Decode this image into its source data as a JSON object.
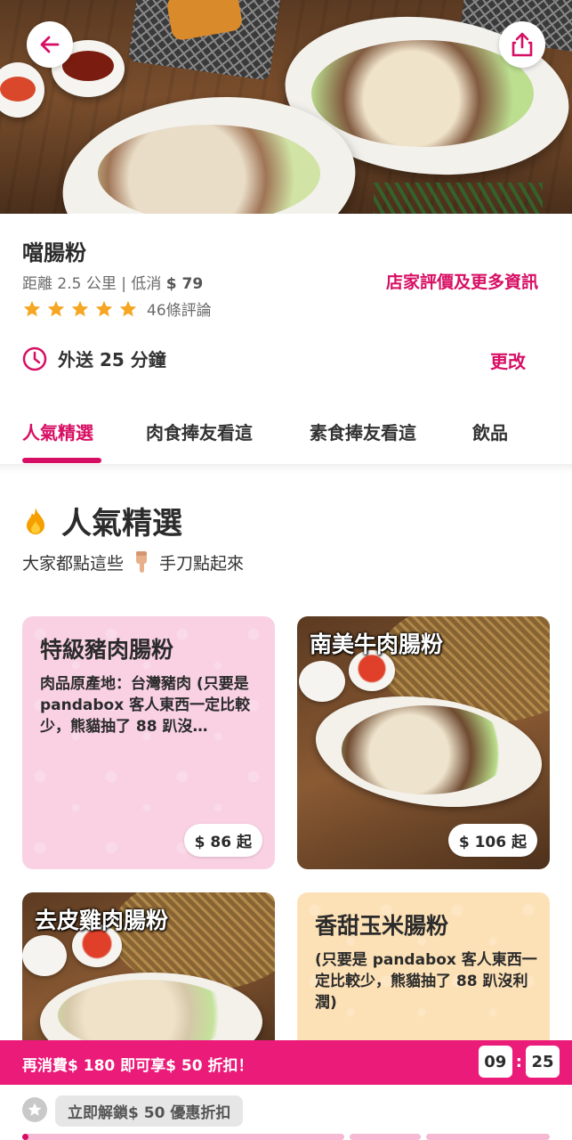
{
  "header": {
    "back_icon": "arrow-left-icon",
    "share_icon": "share-icon"
  },
  "shop": {
    "name": "噹腸粉",
    "distance_label": "距離 2.5 公里 | 低消 ",
    "min_order": "$ 79",
    "more_info": "店家評價及更多資訊",
    "rating_stars": 5,
    "rating_count": "46條評論",
    "star_color": "#f5a623"
  },
  "delivery": {
    "clock_icon": "clock-icon",
    "label": "外送 25 分鐘",
    "change": "更改"
  },
  "tabs": [
    {
      "label": "人氣精選",
      "active": true
    },
    {
      "label": "肉食捧友看這",
      "active": false
    },
    {
      "label": "素食捧友看這",
      "active": false
    },
    {
      "label": "飲品",
      "active": false
    }
  ],
  "section": {
    "fire_icon": "fire-icon",
    "title": "人氣精選",
    "subtitle_before": "大家都點這些",
    "pointing_icon": "pointing-down-hand-icon",
    "subtitle_after": "手刀點起來"
  },
  "cards": [
    {
      "title": "特級豬肉腸粉",
      "description": "肉品原產地：台灣豬肉 (只要是 pandabox 客人東西一定比較少，熊貓抽了 88 趴沒…",
      "price": "$ 86 起",
      "style": "pink"
    },
    {
      "title": "南美牛肉腸粉",
      "description": "",
      "price": "$ 106 起",
      "style": "photo"
    },
    {
      "title": "去皮雞肉腸粉",
      "description": "",
      "price": "",
      "style": "photo"
    },
    {
      "title": "香甜玉米腸粉",
      "description": "(只要是 pandabox 客人東西一定比較少，熊貓抽了 88 趴沒利潤)",
      "price": "",
      "style": "yellow"
    }
  ],
  "promo": {
    "text": "再消費$ 180 即可享$ 50 折扣！",
    "timer_minutes": "09",
    "timer_seconds": "25",
    "bar_color": "#ea1b79"
  },
  "unlock": {
    "star_icon": "star-icon",
    "label": "立即解鎖$ 50 優惠折扣",
    "progress_fraction": 0.02
  },
  "colors": {
    "accent": "#d70f64",
    "pink_card": "#f9d1e3",
    "yellow_card": "#fde1b6"
  }
}
